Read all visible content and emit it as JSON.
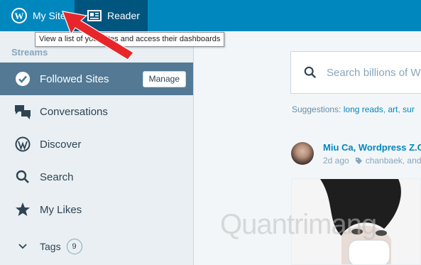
{
  "masterbar": {
    "my_site_label": "My Site",
    "reader_label": "Reader",
    "wp_glyph": "W"
  },
  "tooltip": {
    "text": "View a list of your sites and access their dashboards"
  },
  "sidebar": {
    "heading": "Streams",
    "items": [
      {
        "label": "Followed Sites",
        "icon": "checkmark-circle-icon",
        "selected": true
      },
      {
        "label": "Conversations",
        "icon": "chat-bubbles-icon"
      },
      {
        "label": "Discover",
        "icon": "wordpress-logo-icon"
      },
      {
        "label": "Search",
        "icon": "search-icon"
      },
      {
        "label": "My Likes",
        "icon": "star-icon"
      },
      {
        "label": "Tags",
        "icon": "chevron-down-icon",
        "count": "9"
      }
    ],
    "manage_label": "Manage"
  },
  "main": {
    "search_placeholder": "Search billions of W",
    "suggestions_label": "Suggestions:",
    "suggestions": [
      "long reads",
      "art",
      "sur"
    ],
    "post": {
      "author": "Miu Ca, Wordpress Z.O.",
      "age": "2d ago",
      "tag": "chanbaek, and"
    }
  },
  "watermark": "Quantrimang",
  "colors": {
    "masterbar": "#0087be",
    "masterbar_active": "#00557f",
    "sidebar_bg": "#e9eff3",
    "selected_bg": "#537994",
    "link": "#0087be",
    "arrow": "#e8262a"
  }
}
